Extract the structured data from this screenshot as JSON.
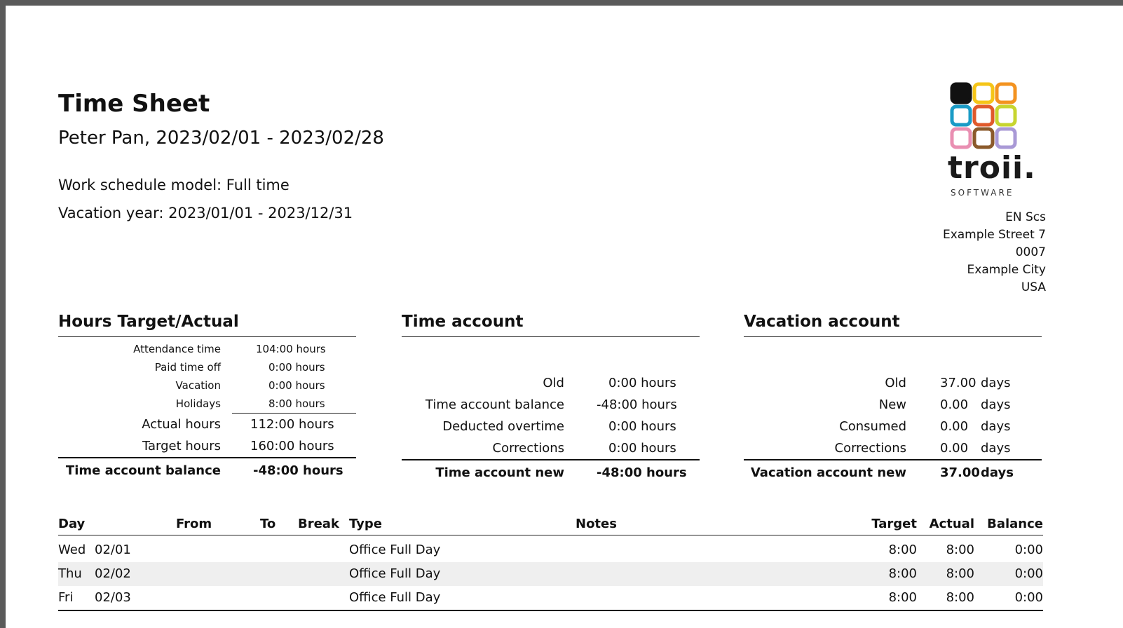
{
  "header": {
    "title": "Time Sheet",
    "subtitle": "Peter Pan, 2023/02/01 - 2023/02/28",
    "schedule": "Work schedule model: Full time",
    "vacation_year": "Vacation year: 2023/01/01 - 2023/12/31"
  },
  "logo": {
    "word": "troii.",
    "sub": "SOFTWARE",
    "colors": [
      "#111111",
      "#f5c518",
      "#f39320",
      "#1a9bc6",
      "#e05a2b",
      "#c7d530",
      "#e98fb2",
      "#8b5a2b",
      "#a999d6"
    ]
  },
  "address": [
    "EN Scs",
    "Example Street 7",
    "0007",
    "Example City",
    "USA"
  ],
  "hours": {
    "title": "Hours Target/Actual",
    "rows": [
      {
        "label": "Attendance time",
        "value": "104:00 hours"
      },
      {
        "label": "Paid time off",
        "value": "0:00 hours"
      },
      {
        "label": "Vacation",
        "value": "0:00 hours"
      },
      {
        "label": "Holidays",
        "value": "8:00 hours"
      }
    ],
    "actual": {
      "label": "Actual hours",
      "value": "112:00 hours"
    },
    "target": {
      "label": "Target hours",
      "value": "160:00 hours"
    },
    "total": {
      "label": "Time account balance",
      "value": "-48:00 hours"
    }
  },
  "time_account": {
    "title": "Time account",
    "rows": [
      {
        "label": "Old",
        "value": "0:00 hours"
      },
      {
        "label": "Time account balance",
        "value": "-48:00 hours"
      },
      {
        "label": "Deducted overtime",
        "value": "0:00 hours"
      },
      {
        "label": "Corrections",
        "value": "0:00 hours"
      }
    ],
    "total": {
      "label": "Time account new",
      "value": "-48:00 hours"
    }
  },
  "vacation_account": {
    "title": "Vacation account",
    "rows": [
      {
        "label": "Old",
        "value": "37.00",
        "unit": "days"
      },
      {
        "label": "New",
        "value": "0.00",
        "unit": "days"
      },
      {
        "label": "Consumed",
        "value": "0.00",
        "unit": "days"
      },
      {
        "label": "Corrections",
        "value": "0.00",
        "unit": "days"
      }
    ],
    "total": {
      "label": "Vacation account new",
      "value": "37.00",
      "unit": "days"
    }
  },
  "table": {
    "headers": {
      "day": "Day",
      "from": "From",
      "to": "To",
      "break": "Break",
      "type": "Type",
      "notes": "Notes",
      "target": "Target",
      "actual": "Actual",
      "balance": "Balance"
    },
    "rows": [
      {
        "day": "Wed",
        "date": "02/01",
        "type": "Office Full Day",
        "target": "8:00",
        "actual": "8:00",
        "balance": "0:00"
      },
      {
        "day": "Thu",
        "date": "02/02",
        "type": "Office Full Day",
        "target": "8:00",
        "actual": "8:00",
        "balance": "0:00"
      },
      {
        "day": "Fri",
        "date": "02/03",
        "type": "Office Full Day",
        "target": "8:00",
        "actual": "8:00",
        "balance": "0:00"
      }
    ]
  }
}
